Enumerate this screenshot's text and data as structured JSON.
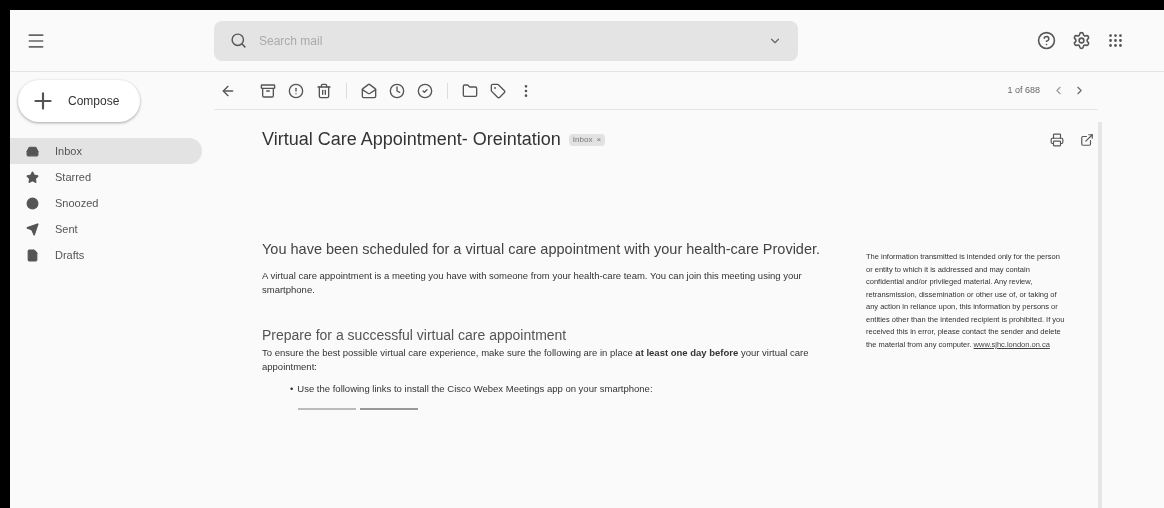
{
  "search": {
    "placeholder": "Search mail"
  },
  "compose": {
    "label": "Compose"
  },
  "sidebar": {
    "items": [
      {
        "label": "Inbox",
        "selected": true
      },
      {
        "label": "Starred",
        "selected": false
      },
      {
        "label": "Snoozed",
        "selected": false
      },
      {
        "label": "Sent",
        "selected": false
      },
      {
        "label": "Drafts",
        "selected": false
      }
    ]
  },
  "toolbar": {
    "pager": "1 of 688"
  },
  "message": {
    "subject": "Virtual Care Appointment- Oreintation",
    "label_chip": {
      "label": "Inbox",
      "remove": "×"
    },
    "heading": "You have been scheduled for a virtual care appointment with your health-care Provider.",
    "intro": "A virtual care appointment is a meeting you have with someone from your health-care team. You can join this meeting using your smartphone.",
    "subheading": "Prepare for a successful virtual care appointment",
    "prepare": "To ensure the best possible virtual care experience, make sure the following are in place **at least one day before** your virtual care appointment:",
    "bullet_marker": "•",
    "bullets": [
      "Use the following links to install the Cisco Webex Meetings app on your smartphone:"
    ],
    "disclaimer": "The information transmitted is intended only for the person or entity to which it is addressed and may contain confidential and/or privileged material. Any review, retransmission, dissemination or other use of, or taking of any action in reliance upon, this information by persons or entities other than the intended recipient is prohibited. If you received this in error, please contact the sender and delete the material from any computer.",
    "disclaimer_link": "www.sjhc.london.on.ca"
  }
}
